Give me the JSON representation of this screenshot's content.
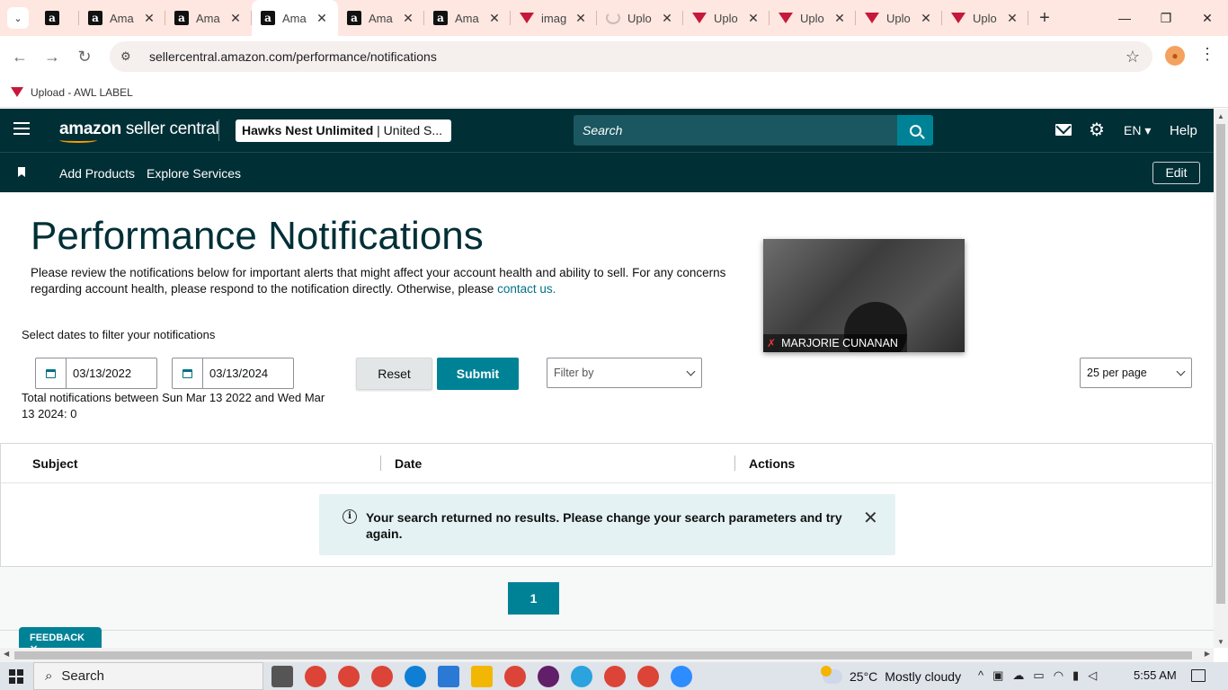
{
  "browser": {
    "tabs": [
      {
        "favicon": "amazon",
        "title": ""
      },
      {
        "favicon": "amazon",
        "title": "Ama"
      },
      {
        "favicon": "amazon",
        "title": "Ama"
      },
      {
        "favicon": "amazon",
        "title": "Ama",
        "active": true
      },
      {
        "favicon": "amazon",
        "title": "Ama"
      },
      {
        "favicon": "amazon",
        "title": "Ama"
      },
      {
        "favicon": "triangle",
        "title": "imag"
      },
      {
        "favicon": "spinner",
        "title": "Uplo"
      },
      {
        "favicon": "triangle",
        "title": "Uplo"
      },
      {
        "favicon": "triangle",
        "title": "Uplo"
      },
      {
        "favicon": "triangle",
        "title": "Uplo"
      },
      {
        "favicon": "triangle",
        "title": "Uplo"
      }
    ],
    "url": "sellercentral.amazon.com/performance/notifications",
    "bookmark": "Upload - AWL LABEL"
  },
  "header": {
    "logo_bold": "amazon",
    "logo_rest": " seller central",
    "store_name": "Hawks Nest Unlimited",
    "store_region": " | United S...",
    "search_placeholder": "Search",
    "language": "EN",
    "help": "Help",
    "nav": {
      "add_products": "Add Products",
      "explore_services": "Explore Services",
      "edit": "Edit"
    }
  },
  "main": {
    "title": "Performance Notifications",
    "intro": "Please review the notifications below for important alerts that might affect your account health and ability to sell. For any concerns regarding account health, please respond to the notification directly. Otherwise, please ",
    "contact_link": "contact us.",
    "filter_label": "Select dates to filter your notifications",
    "start_date": "03/13/2022",
    "end_date": "03/13/2024",
    "reset": "Reset",
    "submit": "Submit",
    "filter_by": "Filter by",
    "per_page": "25 per page",
    "total": "Total notifications between Sun Mar 13 2022 and Wed Mar 13 2024: 0",
    "columns": [
      "Subject",
      "Date",
      "Actions"
    ],
    "alert": "Your search returned no results. Please change your search parameters and try again.",
    "page": "1",
    "feedback": "FEEDBACK ✕"
  },
  "video": {
    "name": "MARJORIE CUNANAN"
  },
  "taskbar": {
    "search": "Search",
    "temperature": "25°C",
    "weather": "Mostly cloudy",
    "time": "5:55 AM"
  },
  "colors": {
    "header_bg": "#002f36",
    "accent": "#008296",
    "tab_strip": "#fde7e0"
  }
}
